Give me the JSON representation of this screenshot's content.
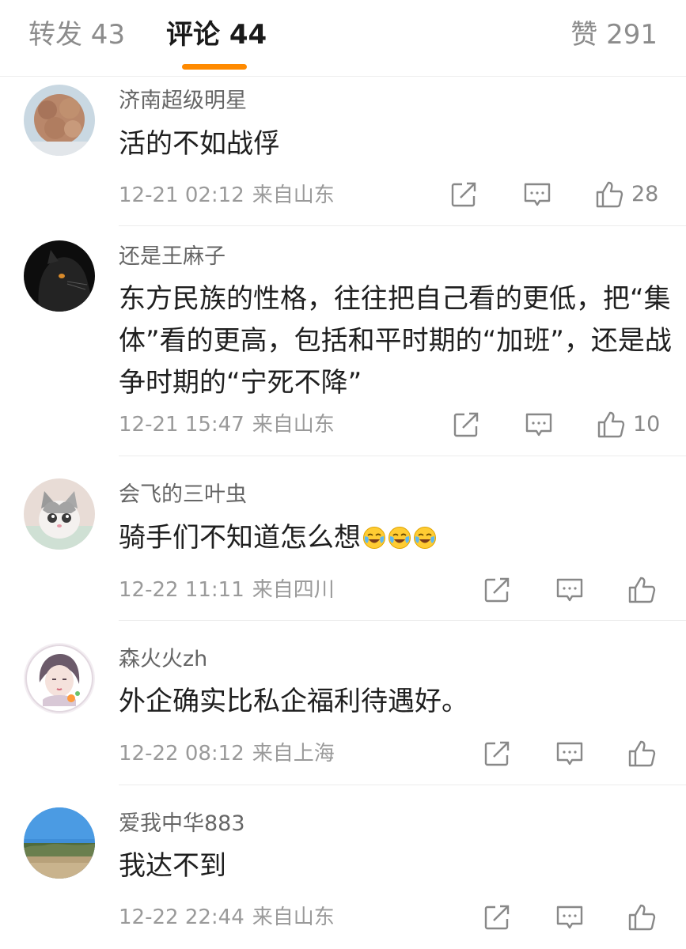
{
  "tabs": {
    "forward": "转发 43",
    "comments": "评论 44",
    "likes": "赞 291"
  },
  "colors": {
    "accent": "#ff8a00",
    "text": "#1f1f1f",
    "meta": "#9a9a9a"
  },
  "comments": [
    {
      "user": "济南超级明星",
      "text": "活的不如战俘",
      "time": "12-21 02:12",
      "location": "来自山东",
      "likes": "28",
      "avatar": "fluffy-dog-avatar"
    },
    {
      "user": "还是王麻子",
      "text": "东方民族的性格，往往把自己看的更低，把“集体”看的更高，包括和平时期的“加班”，还是战争时期的“宁死不降”",
      "time": "12-21 15:47",
      "location": "来自山东",
      "likes": "10",
      "avatar": "black-cat-avatar"
    },
    {
      "user": "会飞的三叶虫",
      "text": "骑手们不知道怎么想",
      "time": "12-22 11:11",
      "location": "来自四川",
      "likes": "",
      "avatar": "kitten-avatar",
      "emoji": "crying-laughing-emoji"
    },
    {
      "user": "森火火zh",
      "text": "外企确实比私企福利待遇好。",
      "time": "12-22 08:12",
      "location": "来自上海",
      "likes": "",
      "avatar": "anime-girl-avatar"
    },
    {
      "user": "爱我中华883",
      "text": "我达不到",
      "time": "12-22 22:44",
      "location": "来自山东",
      "likes": "",
      "avatar": "landscape-avatar"
    }
  ],
  "icons": {
    "share": "share-icon",
    "reply": "comment-icon",
    "like": "thumbs-up-icon"
  }
}
